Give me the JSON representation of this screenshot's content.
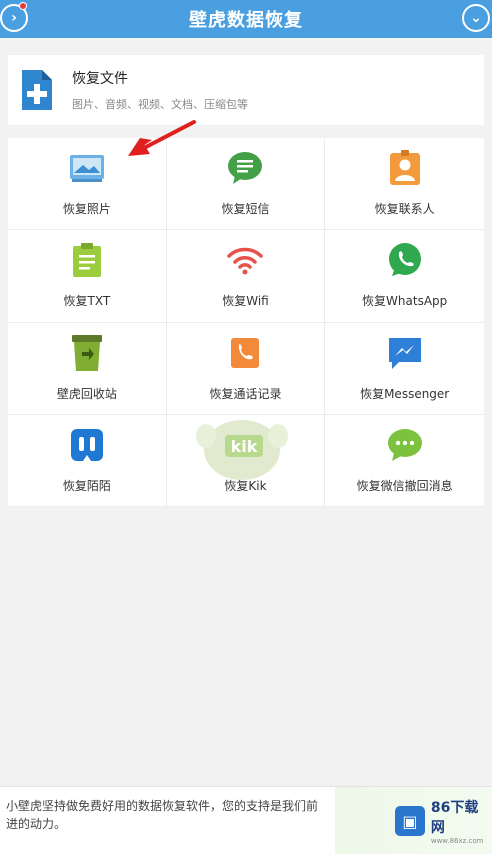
{
  "header": {
    "title": "壁虎数据恢复",
    "left_icon": "chevron-right-icon",
    "right_icon": "chevron-down-icon",
    "accent_color": "#4a9fe0"
  },
  "files_card": {
    "title": "恢复文件",
    "subtitle": "图片、音频、视频、文档、压缩包等"
  },
  "grid": [
    {
      "label": "恢复照片",
      "icon": "photo-icon"
    },
    {
      "label": "恢复短信",
      "icon": "sms-icon"
    },
    {
      "label": "恢复联系人",
      "icon": "contacts-icon"
    },
    {
      "label": "恢复TXT",
      "icon": "txt-icon"
    },
    {
      "label": "恢复Wifi",
      "icon": "wifi-icon"
    },
    {
      "label": "恢复WhatsApp",
      "icon": "whatsapp-icon"
    },
    {
      "label": "壁虎回收站",
      "icon": "recycle-bin-icon"
    },
    {
      "label": "恢复通话记录",
      "icon": "call-log-icon"
    },
    {
      "label": "恢复Messenger",
      "icon": "messenger-icon"
    },
    {
      "label": "恢复陌陌",
      "icon": "momo-icon"
    },
    {
      "label": "恢复Kik",
      "icon": "kik-icon"
    },
    {
      "label": "恢复微信撤回消息",
      "icon": "wechat-icon"
    }
  ],
  "footer": {
    "text": "小壁虎坚持做免费好用的数据恢复软件，您的支持是我们前进的动力。",
    "logo_name": "86下载网",
    "logo_url": "www.86xz.com"
  }
}
